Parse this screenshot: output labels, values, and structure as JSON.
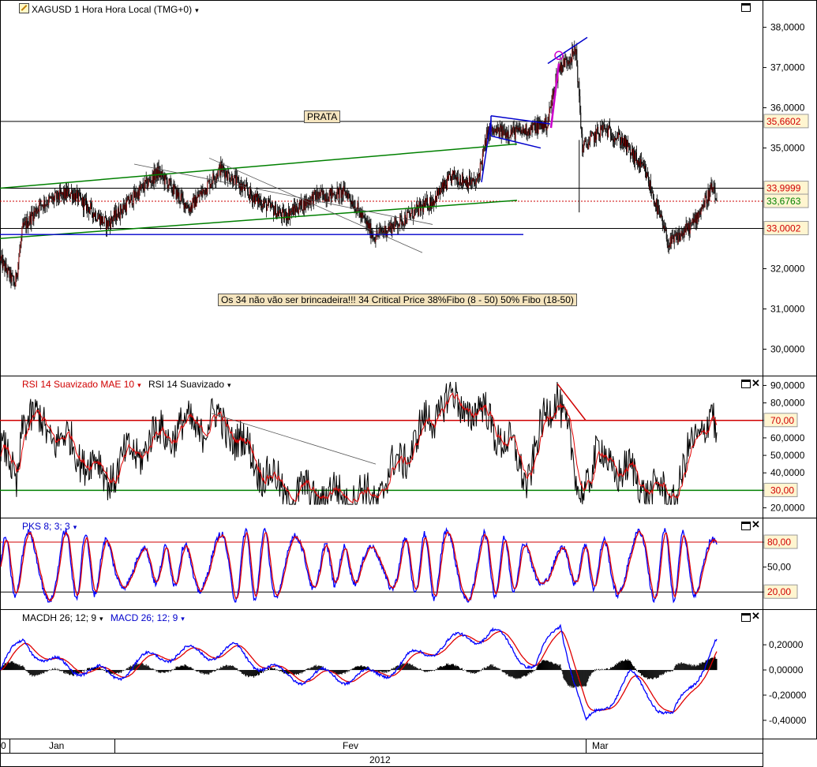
{
  "header": {
    "title": "XAGUSD 1 Hora Hora Local (TMG+0)",
    "caret": "▾"
  },
  "annotations": {
    "prata": "PRATA",
    "note": "Os 34 não vão ser brincadeira!!!    34  Critical Price    38%Fibo (8 - 50) 50% Fibo (18-50)"
  },
  "price_panel": {
    "axis_ticks": [
      "38,0000",
      "37,0000",
      "36,0000",
      "35,0000",
      "34,0000",
      "33,0000",
      "32,0000",
      "31,0000",
      "30,0000"
    ],
    "tick_values": [
      38,
      37,
      36,
      35,
      34,
      33,
      32,
      31,
      30
    ],
    "levels": {
      "resistance": "35,6602",
      "resistance_value": 35.6602,
      "upper": "33,9999",
      "upper_value": 33.9999,
      "current": "33,6763",
      "current_value": 33.6763,
      "support": "33,0002",
      "support_value": 33.0002
    },
    "colors": {
      "level_label": "#d00000",
      "current_label": "#008000",
      "up_candle": "#ffffff",
      "down_candle": "#000000",
      "trend_green": "#008000",
      "trend_blue": "#0000cc",
      "highlight": "#cc00cc"
    }
  },
  "rsi_panel": {
    "legend_a": "RSI 14 Suavizado MAE 10",
    "legend_b": "RSI 14 Suavizado",
    "axis_ticks": [
      "90,0000",
      "80,0000",
      "70,00",
      "60,0000",
      "50,0000",
      "40,0000",
      "30,00",
      "20,0000"
    ],
    "tick_values": [
      90,
      80,
      70,
      60,
      50,
      40,
      30,
      20
    ],
    "overbought": 70,
    "oversold": 30
  },
  "pks_panel": {
    "legend": "PKS 8; 3; 3",
    "axis_ticks": [
      "80,00",
      "50,00",
      "20,00"
    ],
    "tick_values": [
      80,
      50,
      20
    ]
  },
  "macd_panel": {
    "legend_a": "MACDH 26; 12; 9",
    "legend_b": "MACD 26; 12; 9",
    "axis_ticks": [
      "0,20000",
      "0,00000",
      "-0,20000",
      "-0,40000"
    ],
    "tick_values": [
      0.2,
      0,
      -0.2,
      -0.4
    ]
  },
  "time_axis": {
    "months": [
      "Jan",
      "Fev",
      "Mar"
    ],
    "year": "2012",
    "left_stub": "0"
  },
  "chart_data": {
    "type": "candlestick",
    "title": "XAGUSD 1 Hora Hora Local (TMG+0)",
    "x_labels": [
      "Jan",
      "Fev",
      "Mar"
    ],
    "year": "2012",
    "price_ylim": [
      29.5,
      38.6
    ],
    "price_path_key_points": [
      {
        "bar": 0,
        "price": 32.2
      },
      {
        "bar": 18,
        "price": 31.6
      },
      {
        "bar": 28,
        "price": 33.0
      },
      {
        "bar": 50,
        "price": 33.6
      },
      {
        "bar": 90,
        "price": 33.9
      },
      {
        "bar": 135,
        "price": 33.1
      },
      {
        "bar": 160,
        "price": 33.6
      },
      {
        "bar": 200,
        "price": 34.4
      },
      {
        "bar": 240,
        "price": 33.5
      },
      {
        "bar": 280,
        "price": 34.5
      },
      {
        "bar": 320,
        "price": 33.8
      },
      {
        "bar": 360,
        "price": 33.3
      },
      {
        "bar": 400,
        "price": 33.8
      },
      {
        "bar": 440,
        "price": 33.9
      },
      {
        "bar": 475,
        "price": 32.8
      },
      {
        "bar": 510,
        "price": 33.2
      },
      {
        "bar": 550,
        "price": 33.7
      },
      {
        "bar": 575,
        "price": 34.3
      },
      {
        "bar": 605,
        "price": 34.1
      },
      {
        "bar": 620,
        "price": 35.4
      },
      {
        "bar": 660,
        "price": 35.4
      },
      {
        "bar": 695,
        "price": 35.6
      },
      {
        "bar": 710,
        "price": 37.0
      },
      {
        "bar": 732,
        "price": 37.4
      },
      {
        "bar": 740,
        "price": 35.0
      },
      {
        "bar": 766,
        "price": 35.5
      },
      {
        "bar": 790,
        "price": 35.2
      },
      {
        "bar": 820,
        "price": 34.4
      },
      {
        "bar": 850,
        "price": 32.6
      },
      {
        "bar": 880,
        "price": 33.1
      },
      {
        "bar": 905,
        "price": 34.0
      },
      {
        "bar": 910,
        "price": 33.7
      }
    ],
    "rsi_key_points": [
      {
        "bar": 0,
        "v": 55
      },
      {
        "bar": 20,
        "v": 32
      },
      {
        "bar": 28,
        "v": 74
      },
      {
        "bar": 90,
        "v": 55
      },
      {
        "bar": 135,
        "v": 38
      },
      {
        "bar": 200,
        "v": 62
      },
      {
        "bar": 280,
        "v": 70
      },
      {
        "bar": 360,
        "v": 28
      },
      {
        "bar": 475,
        "v": 26
      },
      {
        "bar": 565,
        "v": 82
      },
      {
        "bar": 620,
        "v": 72
      },
      {
        "bar": 670,
        "v": 38
      },
      {
        "bar": 708,
        "v": 90
      },
      {
        "bar": 735,
        "v": 28
      },
      {
        "bar": 760,
        "v": 50
      },
      {
        "bar": 852,
        "v": 24
      },
      {
        "bar": 905,
        "v": 80
      },
      {
        "bar": 910,
        "v": 55
      }
    ],
    "macd_key_points": [
      {
        "bar": 0,
        "v": 0.0
      },
      {
        "bar": 30,
        "v": 0.25
      },
      {
        "bar": 60,
        "v": 0.05
      },
      {
        "bar": 100,
        "v": 0.02
      },
      {
        "bar": 140,
        "v": -0.05
      },
      {
        "bar": 200,
        "v": 0.12
      },
      {
        "bar": 300,
        "v": 0.15
      },
      {
        "bar": 360,
        "v": -0.05
      },
      {
        "bar": 475,
        "v": -0.05
      },
      {
        "bar": 560,
        "v": 0.2
      },
      {
        "bar": 625,
        "v": 0.3
      },
      {
        "bar": 680,
        "v": 0.02
      },
      {
        "bar": 712,
        "v": 0.38
      },
      {
        "bar": 745,
        "v": -0.45
      },
      {
        "bar": 800,
        "v": -0.05
      },
      {
        "bar": 855,
        "v": -0.38
      },
      {
        "bar": 908,
        "v": 0.2
      }
    ]
  }
}
